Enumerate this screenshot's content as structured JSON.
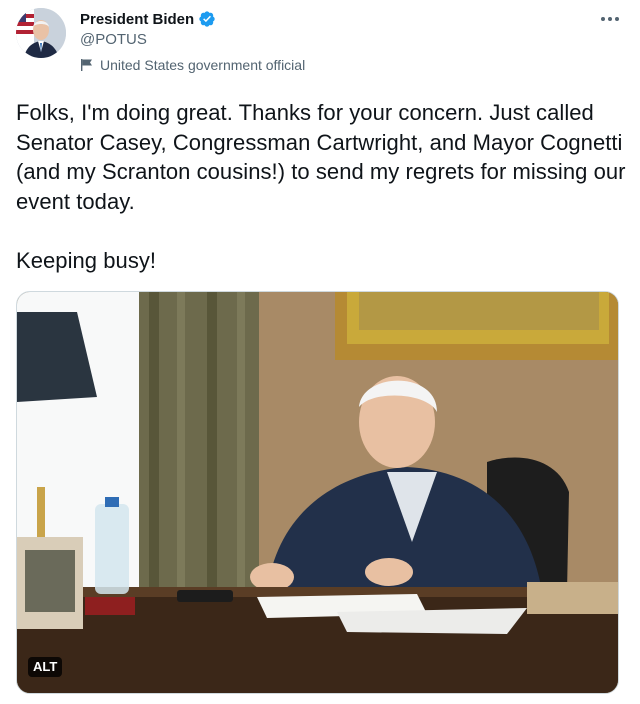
{
  "author": {
    "display_name": "President Biden",
    "handle": "@POTUS",
    "label": "United States government official",
    "avatar": "avatar-photo"
  },
  "icons": {
    "verified": "verified-badge-icon",
    "label": "flag-icon",
    "more": "more-dots-icon"
  },
  "tweet": {
    "text": "Folks, I'm doing great. Thanks for your concern. Just called Senator Casey, Congressman Cartwright, and Mayor Cognetti (and my Scranton cousins!) to send my regrets for missing our event today.\n\nKeeping busy!"
  },
  "media": {
    "alt_label": "ALT"
  },
  "colors": {
    "verified_blue": "#1d9bf0",
    "secondary_text": "#536471",
    "primary_text": "#0f1419"
  }
}
